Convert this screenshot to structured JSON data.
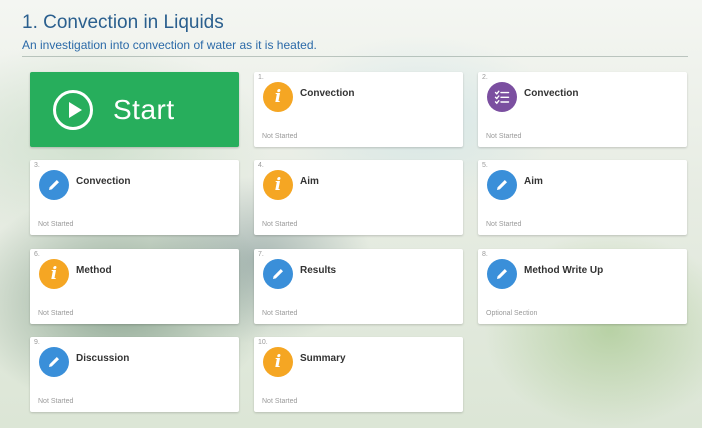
{
  "page": {
    "title": "1. Convection in Liquids",
    "subtitle": "An investigation into convection of water as it is heated."
  },
  "start_tile": {
    "label": "Start"
  },
  "colors": {
    "start_green": "#27ae5c",
    "info_orange": "#f5a623",
    "edit_blue": "#3a8fd9",
    "checklist_purple": "#7b4fa0",
    "title_blue": "#2a5f8e"
  },
  "cards": [
    {
      "num": "1.",
      "title": "Convection",
      "status": "Not Started",
      "icon": "info-icon"
    },
    {
      "num": "2.",
      "title": "Convection",
      "status": "Not Started",
      "icon": "checklist-icon"
    },
    {
      "num": "3.",
      "title": "Convection",
      "status": "Not Started",
      "icon": "pencil-icon"
    },
    {
      "num": "4.",
      "title": "Aim",
      "status": "Not Started",
      "icon": "info-icon"
    },
    {
      "num": "5.",
      "title": "Aim",
      "status": "Not Started",
      "icon": "pencil-icon"
    },
    {
      "num": "6.",
      "title": "Method",
      "status": "Not Started",
      "icon": "info-icon"
    },
    {
      "num": "7.",
      "title": "Results",
      "status": "Not Started",
      "icon": "pencil-icon"
    },
    {
      "num": "8.",
      "title": "Method Write Up",
      "status": "Optional Section",
      "icon": "pencil-icon"
    },
    {
      "num": "9.",
      "title": "Discussion",
      "status": "Not Started",
      "icon": "pencil-icon"
    },
    {
      "num": "10.",
      "title": "Summary",
      "status": "Not Started",
      "icon": "info-icon"
    }
  ]
}
